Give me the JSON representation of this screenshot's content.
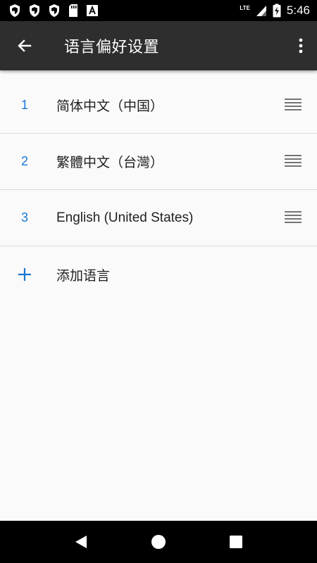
{
  "status_bar": {
    "time": "5:46",
    "network": "LTE",
    "icons": [
      "shield-icon",
      "shield-icon",
      "shield-icon",
      "sd-card-icon",
      "font-a-icon",
      "signal-icon",
      "battery-charging-icon"
    ]
  },
  "toolbar": {
    "title": "语言偏好设置",
    "back_icon": "arrow-back-icon",
    "overflow_icon": "more-vert-icon"
  },
  "languages": [
    {
      "index": "1",
      "label": "简体中文（中国）"
    },
    {
      "index": "2",
      "label": "繁體中文（台灣）"
    },
    {
      "index": "3",
      "label": "English (United States)"
    }
  ],
  "add_language": {
    "label": "添加语言",
    "icon": "plus-icon"
  },
  "colors": {
    "accent": "#1976d2",
    "toolbar": "#2e2e2e",
    "background": "#fafafa"
  },
  "nav_bar": {
    "buttons": [
      "back-triangle-icon",
      "home-circle-icon",
      "recents-square-icon"
    ]
  }
}
